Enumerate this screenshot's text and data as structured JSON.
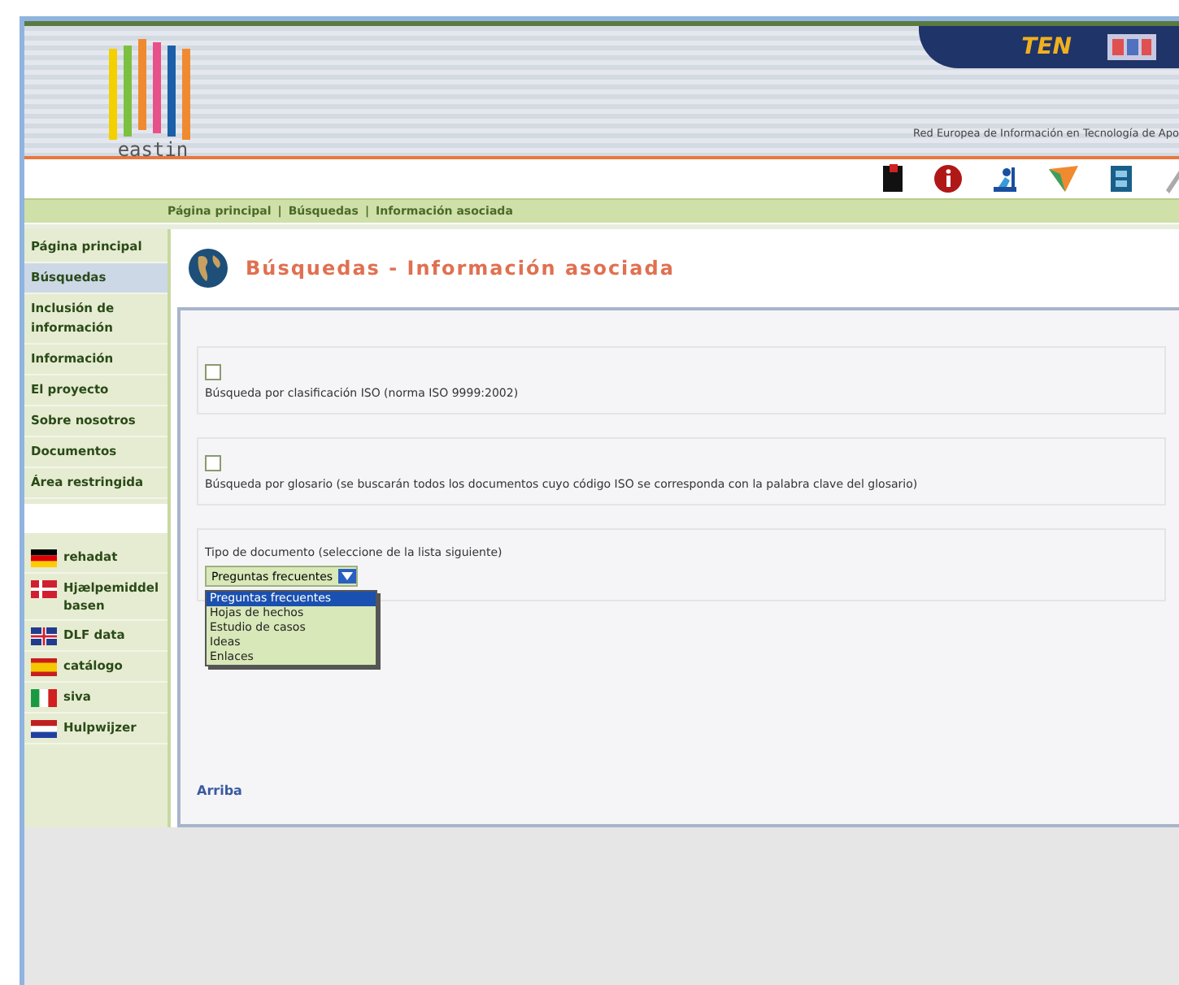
{
  "header": {
    "logo": "eastin",
    "badge": "TEN",
    "tagline": "Red Europea de Información en Tecnología de Apo"
  },
  "breadcrumb": {
    "separator": "|",
    "items": [
      "Página principal",
      "Búsquedas",
      "Información asociada"
    ]
  },
  "sidebar": {
    "items": [
      {
        "label": "Página principal",
        "selected": false
      },
      {
        "label": "Búsquedas",
        "selected": true
      },
      {
        "label": "Inclusión de información",
        "selected": false
      },
      {
        "label": "Información",
        "selected": false
      },
      {
        "label": "El proyecto",
        "selected": false
      },
      {
        "label": "Sobre nosotros",
        "selected": false
      },
      {
        "label": "Documentos",
        "selected": false
      },
      {
        "label": "Área restringida",
        "selected": false
      }
    ],
    "databases": [
      {
        "kind": "de",
        "label": "rehadat"
      },
      {
        "kind": "dk",
        "label": "Hjælpemiddelbasen"
      },
      {
        "kind": "uk",
        "label": "DLF data"
      },
      {
        "kind": "es",
        "label": "catálogo"
      },
      {
        "kind": "it",
        "label": "siva"
      },
      {
        "kind": "nl",
        "label": "Hulpwijzer"
      }
    ]
  },
  "page_title": "Búsquedas - Información asociada",
  "options": [
    {
      "label": "Búsqueda por clasificación ISO (norma ISO 9999:2002)",
      "checked": false
    },
    {
      "label": "Búsqueda por glosario (se buscarán todos los documentos cuyo código ISO se corresponda con la palabra clave del glosario)",
      "checked": false
    }
  ],
  "document_type": {
    "label": "Tipo de documento (seleccione de la lista siguiente)",
    "value": "Preguntas frecuentes",
    "expanded": true,
    "choices": [
      {
        "label": "Preguntas frecuentes",
        "selected": true
      },
      {
        "label": "Hojas de hechos",
        "selected": false
      },
      {
        "label": "Estudio de casos",
        "selected": false
      },
      {
        "label": "Ideas",
        "selected": false
      },
      {
        "label": "Enlaces",
        "selected": false
      }
    ]
  },
  "top_link": "Arriba"
}
